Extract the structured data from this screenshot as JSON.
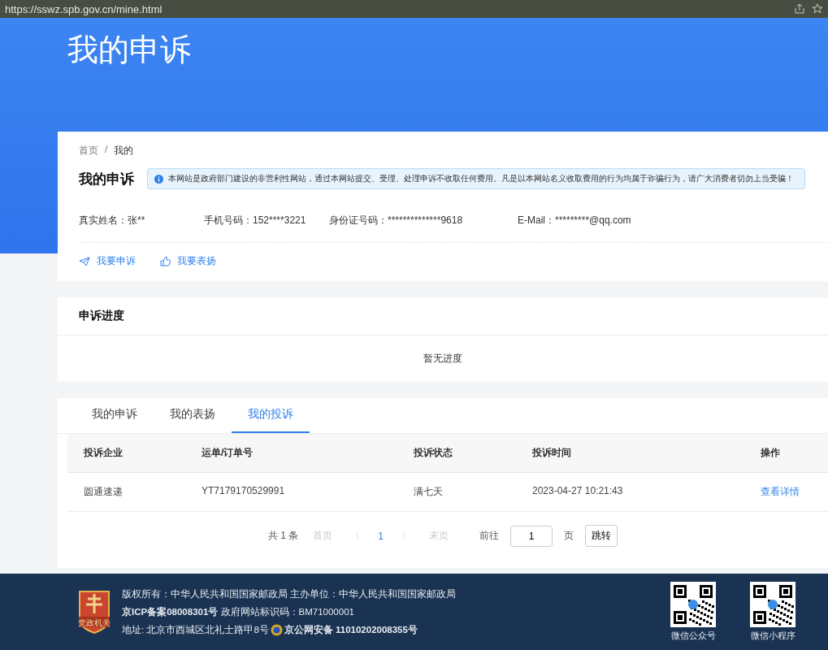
{
  "browser": {
    "url": "https://sswz.spb.gov.cn/mine.html"
  },
  "banner": {
    "title": "我的申诉"
  },
  "breadcrumb": [
    {
      "label": "首页"
    },
    {
      "label": "我的"
    }
  ],
  "breadcrumb_separator": "/",
  "profile": {
    "title": "我的申诉",
    "notice": "本网站是政府部门建设的非营利性网站，通过本网站提交、受理、处理申诉不收取任何费用。凡是以本网站名义收取费用的行为均属于诈骗行为，请广大消费者切勿上当受骗！",
    "fields": [
      {
        "label": "真实姓名：",
        "value": "张**"
      },
      {
        "label": "手机号码：",
        "value": "152****3221"
      },
      {
        "label": "身份证号码：",
        "value": "**************9618"
      },
      {
        "label": "E-Mail：",
        "value": "*********@qq.com"
      }
    ],
    "actions": [
      {
        "kind": "complain",
        "label": "我要申诉"
      },
      {
        "kind": "praise",
        "label": "我要表扬"
      }
    ]
  },
  "progress": {
    "title": "申诉进度",
    "empty": "暂无进度"
  },
  "tabs": [
    {
      "label": "我的申诉",
      "selected": false
    },
    {
      "label": "我的表扬",
      "selected": false
    },
    {
      "label": "我的投诉",
      "selected": true
    }
  ],
  "table": {
    "columns": [
      "投诉企业",
      "运单/订单号",
      "投诉状态",
      "投诉时间",
      "操作"
    ],
    "rows": [
      {
        "cells": [
          "圆通速递",
          "YT7179170529991",
          "满七天",
          "2023-04-27 10:21:43"
        ],
        "action": "查看详情"
      }
    ]
  },
  "pagination": {
    "total": "共 1 条",
    "first": "首页",
    "prev": "〈",
    "pages": [
      {
        "label": "1",
        "selected": true
      }
    ],
    "next": "〉",
    "last": "末页",
    "goto": "前往",
    "page_value": "1",
    "page_unit": "页",
    "jump": "跳转"
  },
  "footer": {
    "logo_text": "党政机关",
    "lines": [
      "版权所有：中华人民共和国国家邮政局 主办单位：中华人民共和国国家邮政局",
      "**京ICP备案08008301号** 政府网站标识码：BM71000001",
      "地址: 北京市西城区北礼士路甲8号"
    ],
    "police": "京公网安备 11010202008355号",
    "qr_codes": [
      {
        "label": "微信公众号"
      },
      {
        "label": "微信小程序"
      }
    ]
  }
}
